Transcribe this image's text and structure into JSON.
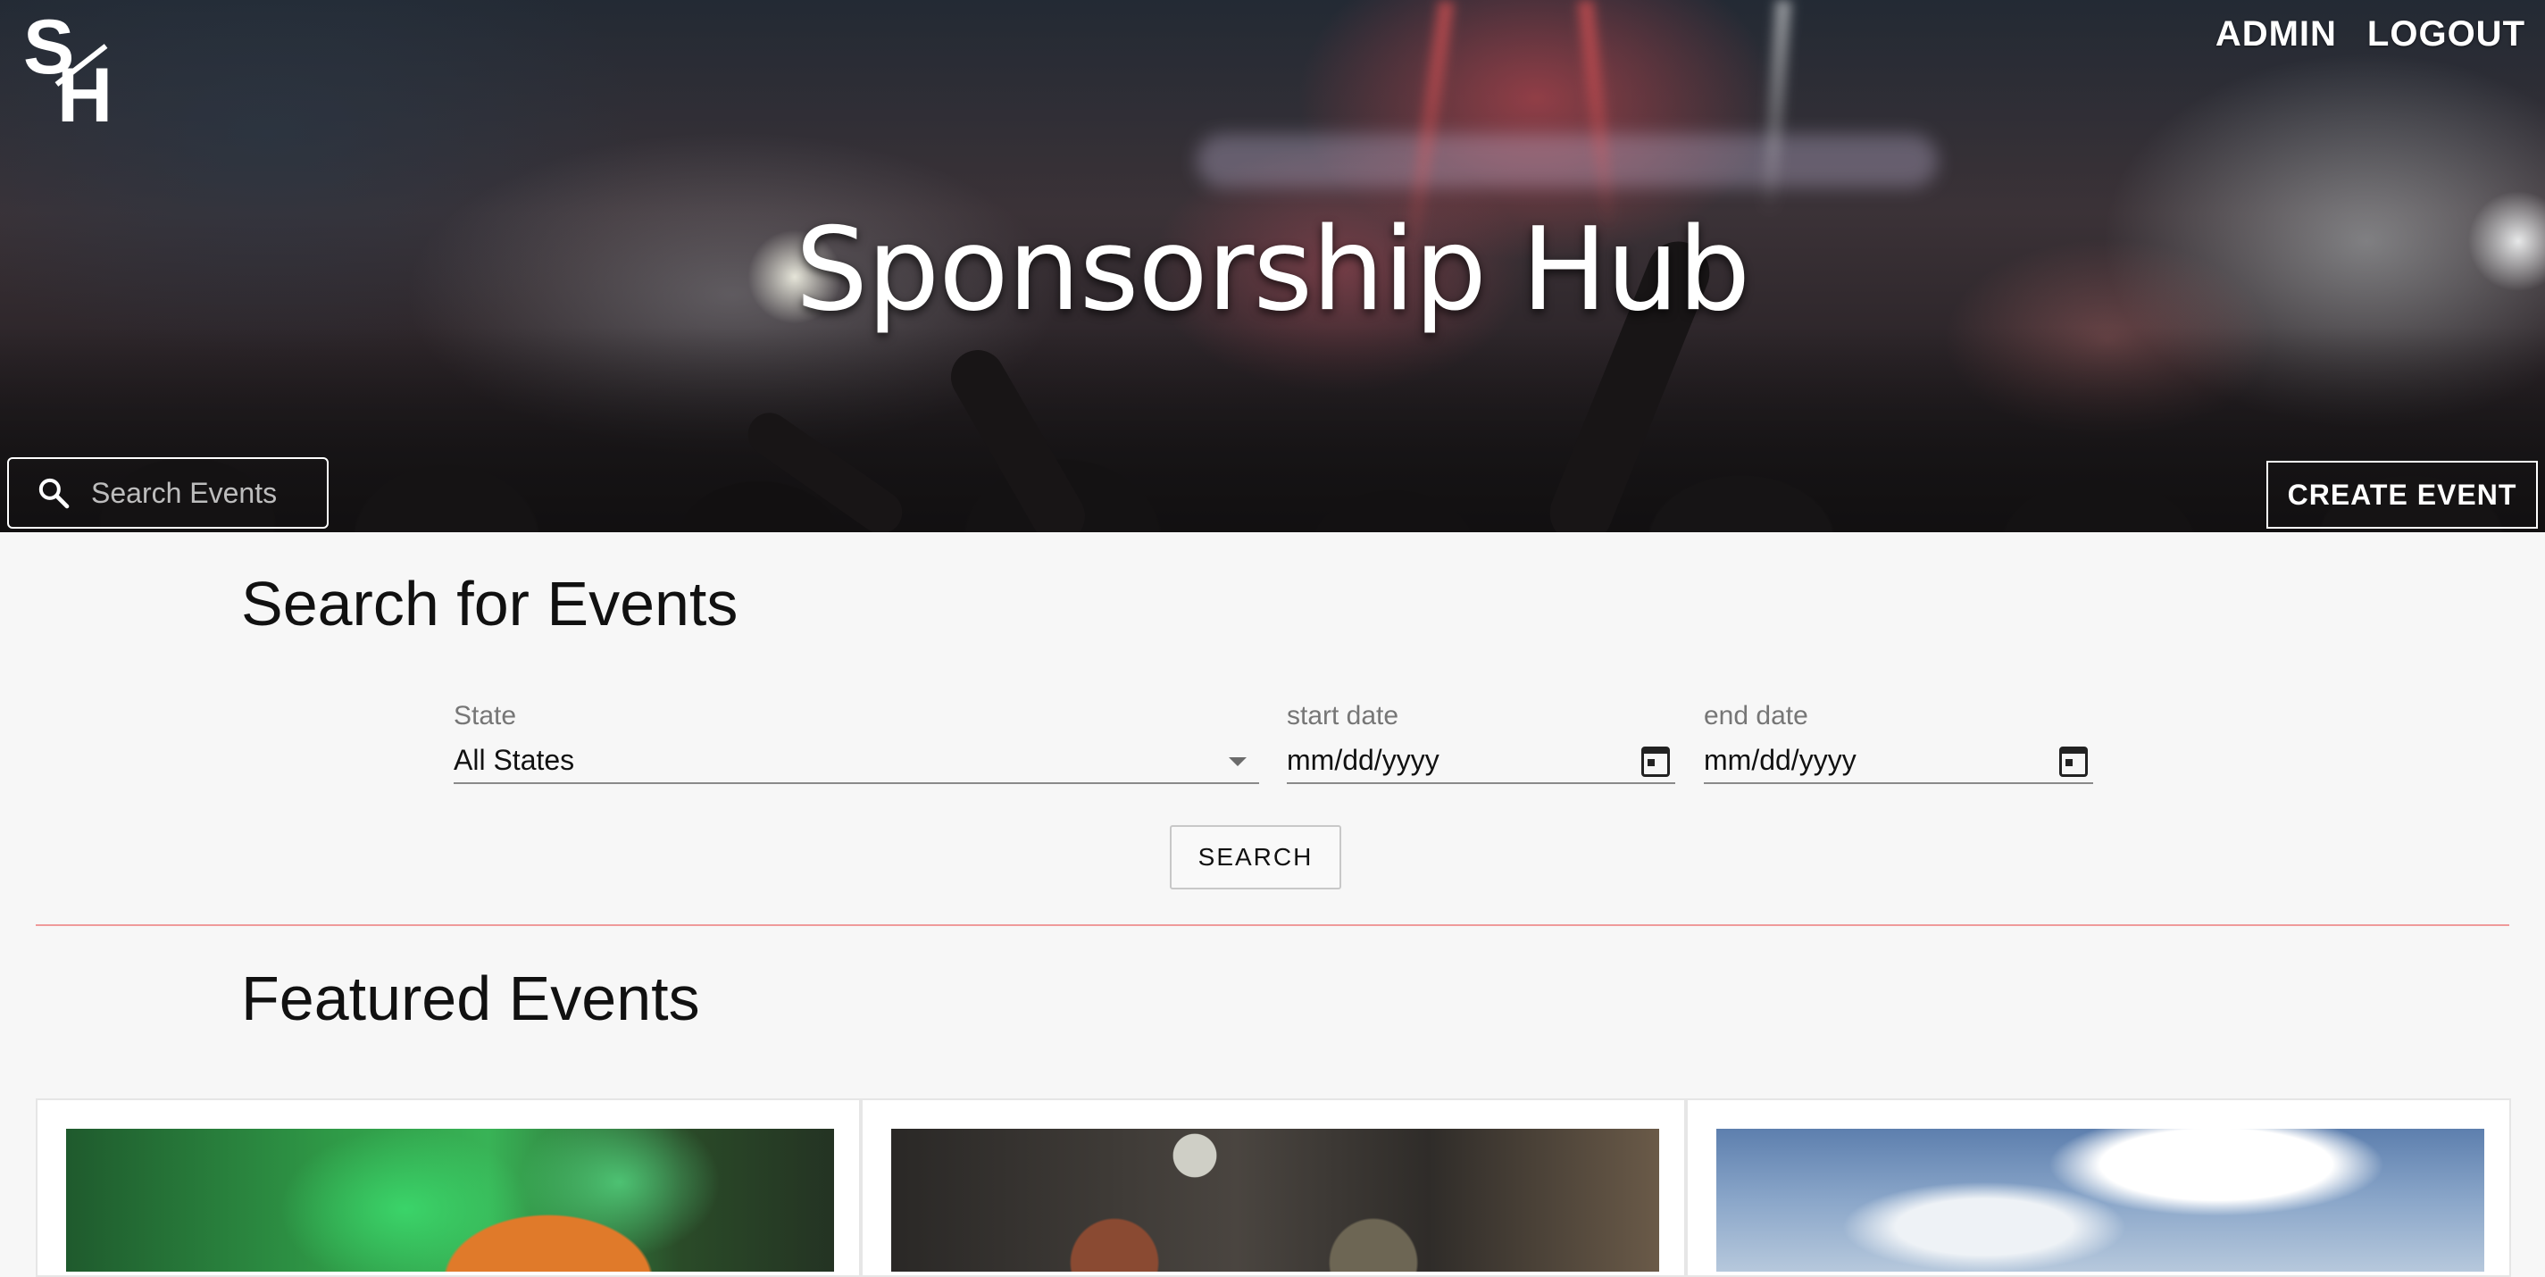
{
  "brand": {
    "logo_text": "SH"
  },
  "nav": {
    "admin_label": "ADMIN",
    "logout_label": "LOGOUT"
  },
  "hero": {
    "title": "Sponsorship Hub",
    "search_placeholder": "Search Events",
    "create_label": "CREATE EVENT"
  },
  "search": {
    "title": "Search for Events",
    "state": {
      "label": "State",
      "value": "All States"
    },
    "start_date": {
      "label": "start date",
      "value": "mm/dd/yyyy"
    },
    "end_date": {
      "label": "end date",
      "value": "mm/dd/yyyy"
    },
    "button_label": "SEARCH"
  },
  "featured": {
    "title": "Featured Events",
    "cards": [
      {
        "image": "pumpkin-green-smoke-image"
      },
      {
        "image": "film-projector-reels-image"
      },
      {
        "image": "cloudy-sky-image"
      }
    ]
  },
  "colors": {
    "divider": "#ef9a9a",
    "page_background": "#f7f7f7"
  }
}
